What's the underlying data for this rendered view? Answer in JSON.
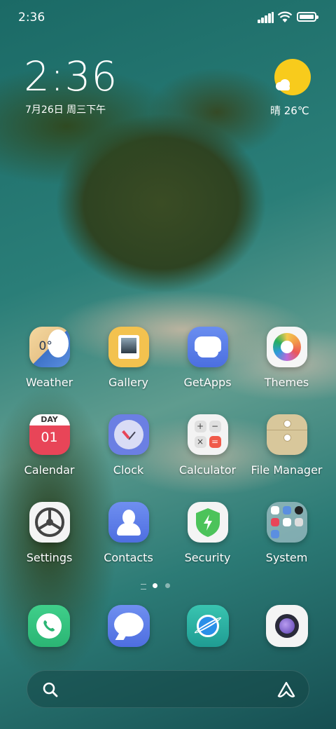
{
  "status_bar": {
    "time": "2:36"
  },
  "widget": {
    "clock": "2:36",
    "date": "7月26日 周三下午",
    "weather": "晴 26℃",
    "weather_icon": "sunny-icon"
  },
  "apps": [
    {
      "label": "Weather",
      "icon": "weather-app-icon"
    },
    {
      "label": "Gallery",
      "icon": "gallery-app-icon"
    },
    {
      "label": "GetApps",
      "icon": "getapps-app-icon"
    },
    {
      "label": "Themes",
      "icon": "themes-app-icon"
    },
    {
      "label": "Calendar",
      "icon": "calendar-app-icon",
      "day_label": "DAY",
      "day_number": "01"
    },
    {
      "label": "Clock",
      "icon": "clock-app-icon"
    },
    {
      "label": "Calculator",
      "icon": "calculator-app-icon"
    },
    {
      "label": "File Manager",
      "icon": "file-manager-app-icon"
    },
    {
      "label": "Settings",
      "icon": "settings-app-icon"
    },
    {
      "label": "Contacts",
      "icon": "contacts-app-icon"
    },
    {
      "label": "Security",
      "icon": "security-app-icon"
    },
    {
      "label": "System",
      "icon": "system-folder-icon"
    }
  ],
  "weather_app_temp": "0°",
  "dock": [
    {
      "icon": "phone-icon"
    },
    {
      "icon": "messages-icon"
    },
    {
      "icon": "browser-icon"
    },
    {
      "icon": "camera-icon"
    }
  ],
  "page_indicator": {
    "pages": 2,
    "current": 1
  },
  "search": {
    "icon": "search-icon",
    "assistant_icon": "assistant-icon"
  },
  "colors": {
    "weather_sun": "#f8cb1c",
    "calendar_red": "#e84558",
    "security_green": "#4cc35a"
  }
}
